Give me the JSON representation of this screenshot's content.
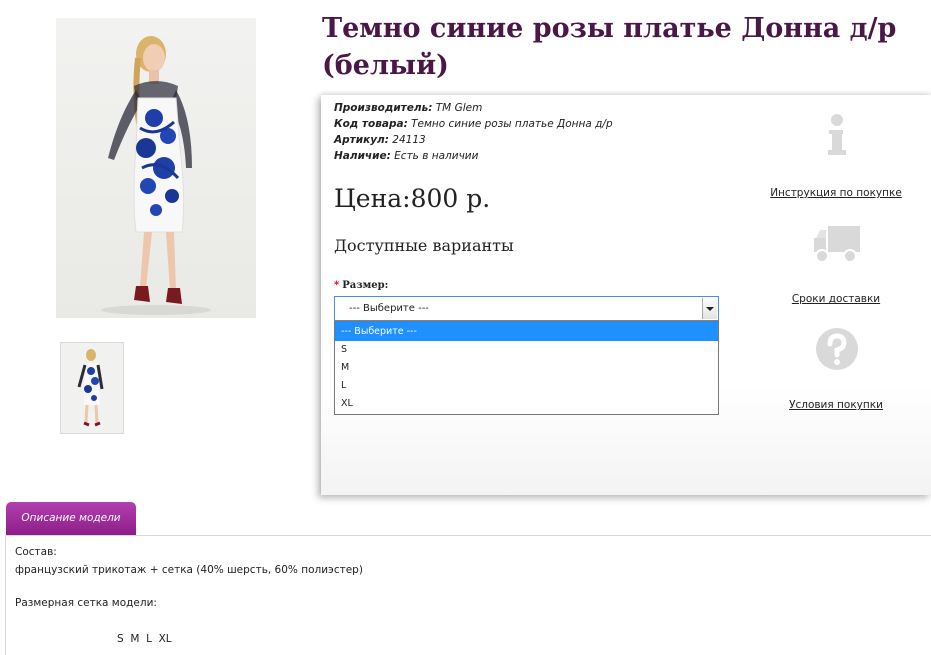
{
  "product": {
    "title": "Темно синие розы платье Донна д/р (белый)",
    "info": [
      {
        "label": "Производитель:",
        "value": "TM Glem"
      },
      {
        "label": "Код товара:",
        "value": "Темно синие розы платье Донна д/р"
      },
      {
        "label": "Артикул:",
        "value": "24113"
      },
      {
        "label": "Наличие:",
        "value": "Есть в наличии"
      }
    ],
    "price": "Цена:800 р.",
    "variants_heading": "Доступные варианты",
    "size_label": "Размер:",
    "size_required_mark": "*",
    "size_select": {
      "selected": "--- Выберите ---",
      "options": [
        "--- Выберите ---",
        "S",
        "M",
        "L",
        "XL"
      ]
    }
  },
  "side_links": {
    "instruction": "Инструкция по покупке",
    "delivery": "Сроки доставки",
    "terms": "Условия покупки"
  },
  "tabs": {
    "description": "Описание модели"
  },
  "description": {
    "composition_label": "Состав:",
    "composition": "французский трикотаж  + сетка (40% шерсть, 60% полиэстер)",
    "size_chart_label": "Размерная сетка модели:",
    "sizes": "S  M  L  XL"
  },
  "colors": {
    "title": "#4a1846",
    "tab": "#a230a0",
    "selected_option": "#1e90ff",
    "icons": "#d9d9d9"
  }
}
